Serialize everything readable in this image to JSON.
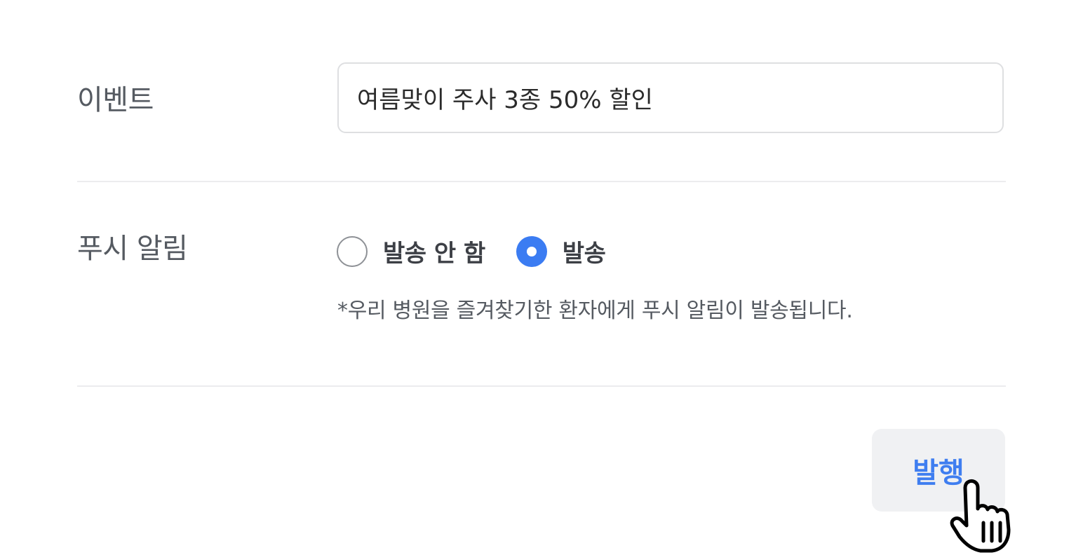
{
  "event": {
    "label": "이벤트",
    "input_value": "여름맞이 주사 3종 50% 할인"
  },
  "push": {
    "label": "푸시 알림",
    "options": [
      {
        "label": "발송 안 함",
        "selected": false
      },
      {
        "label": "발송",
        "selected": true
      }
    ],
    "helper": "*우리 병원을 즐겨찾기한 환자에게 푸시 알림이 발송됩니다."
  },
  "actions": {
    "publish_label": "발행"
  },
  "cursor": {
    "icon": "hand-pointer-icon"
  },
  "colors": {
    "accent": "#3b7cf2",
    "button_bg": "#f0f1f3",
    "label_gray": "#555a61",
    "divider": "#ececee"
  }
}
